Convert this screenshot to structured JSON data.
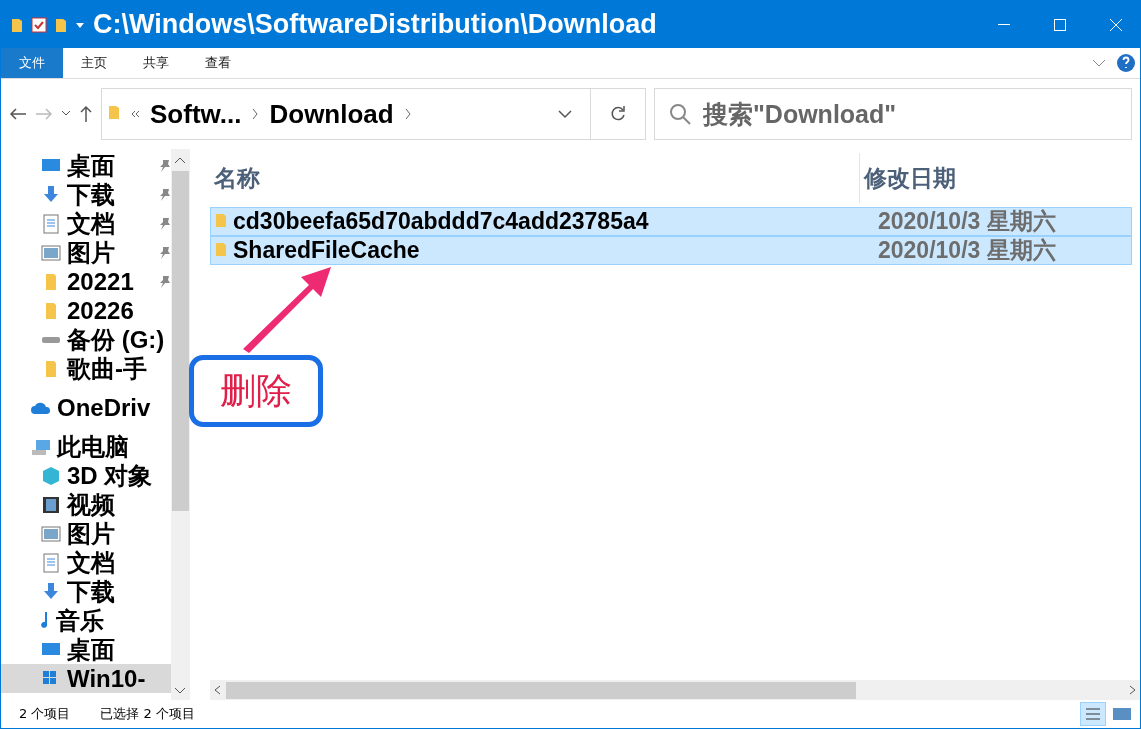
{
  "window": {
    "title": "C:\\Windows\\SoftwareDistribution\\Download"
  },
  "ribbon_tabs": [
    {
      "label": "文件",
      "selected": true
    },
    {
      "label": "主页",
      "selected": false
    },
    {
      "label": "共享",
      "selected": false
    },
    {
      "label": "查看",
      "selected": false
    }
  ],
  "address": {
    "crumbs": [
      "Softw...",
      "Download"
    ]
  },
  "search": {
    "placeholder": "搜索\"Download\""
  },
  "sidebar": {
    "items": [
      {
        "label": "桌面",
        "kind": "desktop",
        "pinned": true,
        "selected": false
      },
      {
        "label": "下载",
        "kind": "download",
        "pinned": true,
        "selected": false
      },
      {
        "label": "文档",
        "kind": "document",
        "pinned": true,
        "selected": false
      },
      {
        "label": "图片",
        "kind": "picture",
        "pinned": true,
        "selected": false
      },
      {
        "label": "20221",
        "kind": "folder",
        "pinned": true,
        "selected": false
      },
      {
        "label": "20226",
        "kind": "folder",
        "selected": false
      },
      {
        "label": "备份 (G:)",
        "kind": "drive",
        "selected": false
      },
      {
        "label": "歌曲-手",
        "kind": "folder",
        "selected": false
      },
      {
        "label": "OneDriv",
        "kind": "cloud",
        "selected": false
      },
      {
        "label": "此电脑",
        "kind": "computer",
        "selected": false,
        "children": [
          {
            "label": "3D 对象",
            "kind": "cube",
            "selected": false
          },
          {
            "label": "视频",
            "kind": "film",
            "selected": false
          },
          {
            "label": "图片",
            "kind": "picture",
            "selected": false
          },
          {
            "label": "文档",
            "kind": "document",
            "selected": false
          },
          {
            "label": "下载",
            "kind": "download",
            "selected": false
          },
          {
            "label": "音乐",
            "kind": "music",
            "selected": false
          },
          {
            "label": "桌面",
            "kind": "desktop",
            "selected": false
          },
          {
            "label": "Win10-",
            "kind": "windrive",
            "selected": true
          }
        ]
      }
    ]
  },
  "table": {
    "columns": [
      "名称",
      "修改日期"
    ],
    "rows": [
      {
        "name": "cd30beefa65d70abddd7c4add23785a4",
        "date": "2020/10/3 星期六",
        "selected": true
      },
      {
        "name": "SharedFileCache",
        "date": "2020/10/3 星期六",
        "selected": true
      }
    ]
  },
  "annotation": {
    "label": "删除"
  },
  "status_bar": [
    "2 个项目",
    "已选择 2 个项目"
  ]
}
